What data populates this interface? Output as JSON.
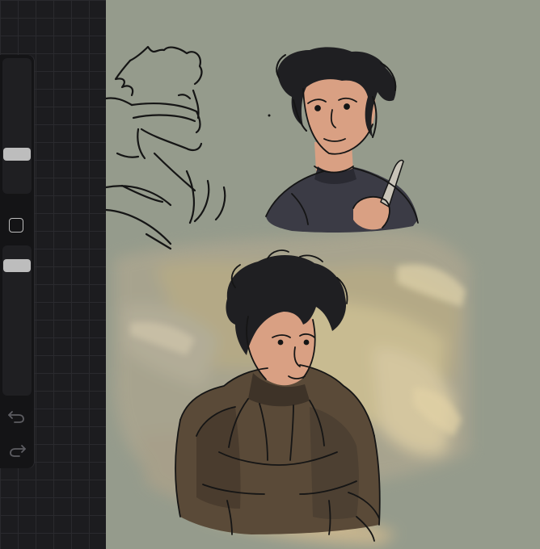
{
  "app": {
    "name": "drawing-canvas"
  },
  "colors": {
    "canvas_background": "#959b8c",
    "sidebar_background": "#141416",
    "grid_background": "#1c1c1f",
    "slider_thumb": "#bdbdbd",
    "sketch_line": "#151515",
    "skin_tone": "#d9a083",
    "jacket_dark": "#3b3b45",
    "jacket_brown": "#5a4a38",
    "sand_highlight": "#d7c8a0"
  },
  "sidebar": {
    "brush_size": {
      "icon": "brush-size-slider",
      "level": 0.32
    },
    "modify_button": {
      "icon": "square-outline-icon"
    },
    "opacity": {
      "icon": "opacity-slider",
      "level": 0.91
    },
    "undo": {
      "icon": "undo-arrow-icon"
    },
    "redo": {
      "icon": "redo-arrow-icon"
    }
  },
  "canvas": {
    "sketches": [
      "line-sketch-figure-with-scarf",
      "colored-portrait-with-knife",
      "painted-figure-in-sandstorm"
    ]
  }
}
